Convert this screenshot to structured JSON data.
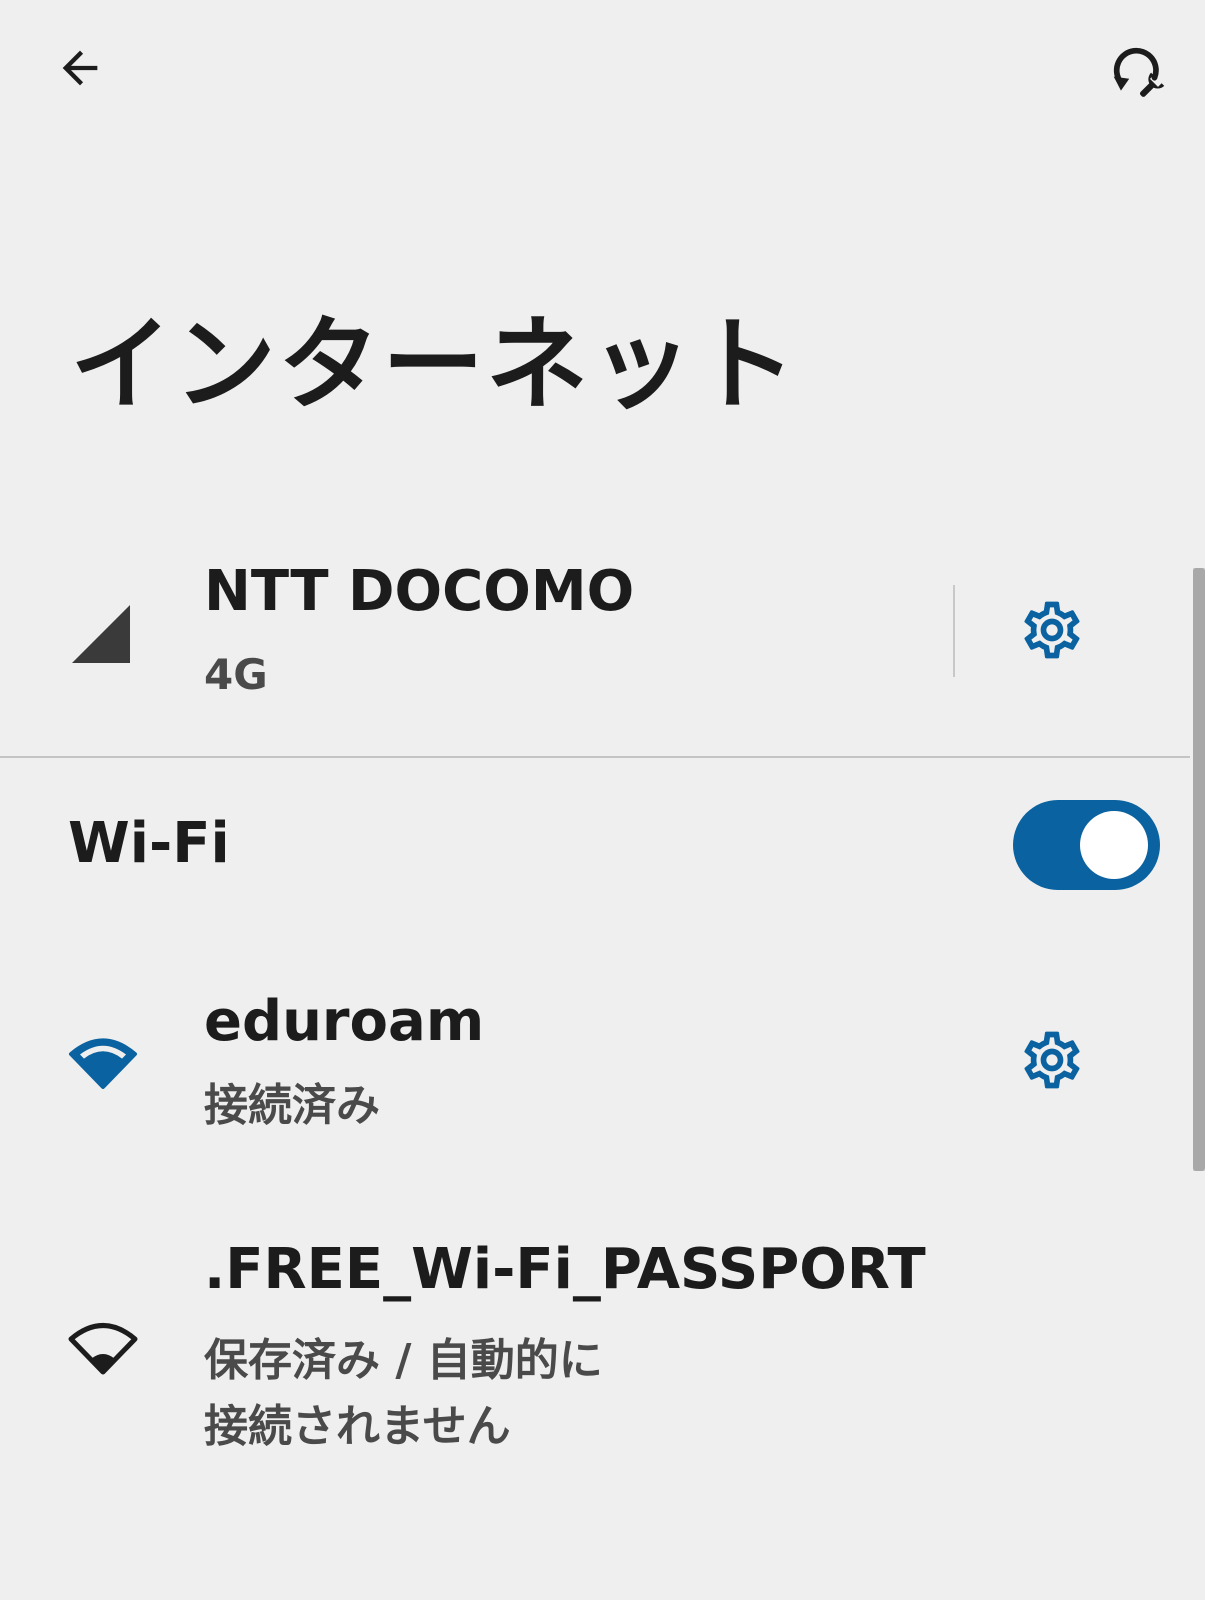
{
  "header": {
    "back_icon": "arrow-back-icon",
    "reset_icon": "network-reset-icon"
  },
  "page": {
    "title": "インターネット"
  },
  "mobile": {
    "carrier_name": "NTT DOCOMO",
    "network_type": "4G",
    "signal_icon": "cellular-signal-icon",
    "settings_icon": "gear-icon"
  },
  "wifi": {
    "label": "Wi-Fi",
    "enabled": true,
    "toggle_color": "#0a62a0"
  },
  "networks": [
    {
      "ssid": "eduroam",
      "status": "接続済み",
      "icon": "wifi-full-icon",
      "icon_color": "#0a62a0",
      "has_settings": true
    },
    {
      "ssid": ".FREE_Wi-Fi_PASSPORT",
      "status": "保存済み / 自動的に接続されません",
      "icon": "wifi-outline-icon",
      "icon_color": "#1c1c1c",
      "has_settings": false
    }
  ],
  "colors": {
    "background": "#efefef",
    "accent": "#0a62a0",
    "text_primary": "#1c1c1c",
    "text_secondary": "#4a4a4a"
  }
}
